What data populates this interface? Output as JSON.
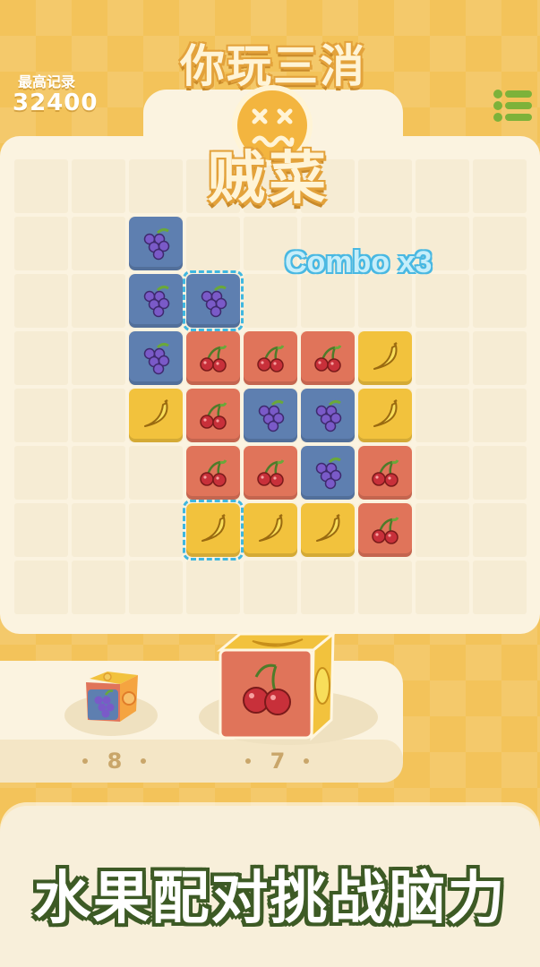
{
  "header": {
    "best_label": "最高记录",
    "best_score": "32400",
    "menu_icon": "list-menu-icon"
  },
  "title": {
    "line1": "你玩三消",
    "line2": "贼菜",
    "face_icon": "dizzy-face-icon"
  },
  "combo_text": "Combo x3",
  "board": {
    "cols": 9,
    "rows": 8,
    "tiles": [
      {
        "row": 1,
        "col": 2,
        "fruit": "grape"
      },
      {
        "row": 2,
        "col": 2,
        "fruit": "grape"
      },
      {
        "row": 2,
        "col": 3,
        "fruit": "grape",
        "selected": true
      },
      {
        "row": 3,
        "col": 2,
        "fruit": "grape"
      },
      {
        "row": 3,
        "col": 3,
        "fruit": "cherry"
      },
      {
        "row": 3,
        "col": 4,
        "fruit": "cherry"
      },
      {
        "row": 3,
        "col": 5,
        "fruit": "cherry"
      },
      {
        "row": 3,
        "col": 6,
        "fruit": "banana"
      },
      {
        "row": 4,
        "col": 2,
        "fruit": "banana"
      },
      {
        "row": 4,
        "col": 3,
        "fruit": "cherry"
      },
      {
        "row": 4,
        "col": 4,
        "fruit": "grape"
      },
      {
        "row": 4,
        "col": 5,
        "fruit": "grape"
      },
      {
        "row": 4,
        "col": 6,
        "fruit": "banana"
      },
      {
        "row": 5,
        "col": 3,
        "fruit": "cherry"
      },
      {
        "row": 5,
        "col": 4,
        "fruit": "cherry"
      },
      {
        "row": 5,
        "col": 5,
        "fruit": "grape"
      },
      {
        "row": 5,
        "col": 6,
        "fruit": "cherry"
      },
      {
        "row": 6,
        "col": 3,
        "fruit": "banana",
        "selected": true
      },
      {
        "row": 6,
        "col": 4,
        "fruit": "banana"
      },
      {
        "row": 6,
        "col": 5,
        "fruit": "banana"
      },
      {
        "row": 6,
        "col": 6,
        "fruit": "cherry"
      }
    ]
  },
  "tray": {
    "small_cube": {
      "count": "8",
      "faces": [
        "grape",
        "orange",
        "cherry"
      ]
    },
    "big_cube": {
      "count": "7",
      "faces": [
        "cherry",
        "lemon",
        "banana"
      ]
    }
  },
  "slogan": "水果配对挑战脑力",
  "colors": {
    "grape": "#5e7fb0",
    "cherry": "#e0745a",
    "banana": "#f2c23d",
    "selection": "#3fb7e0",
    "slogan_outline": "#3d5a25"
  }
}
